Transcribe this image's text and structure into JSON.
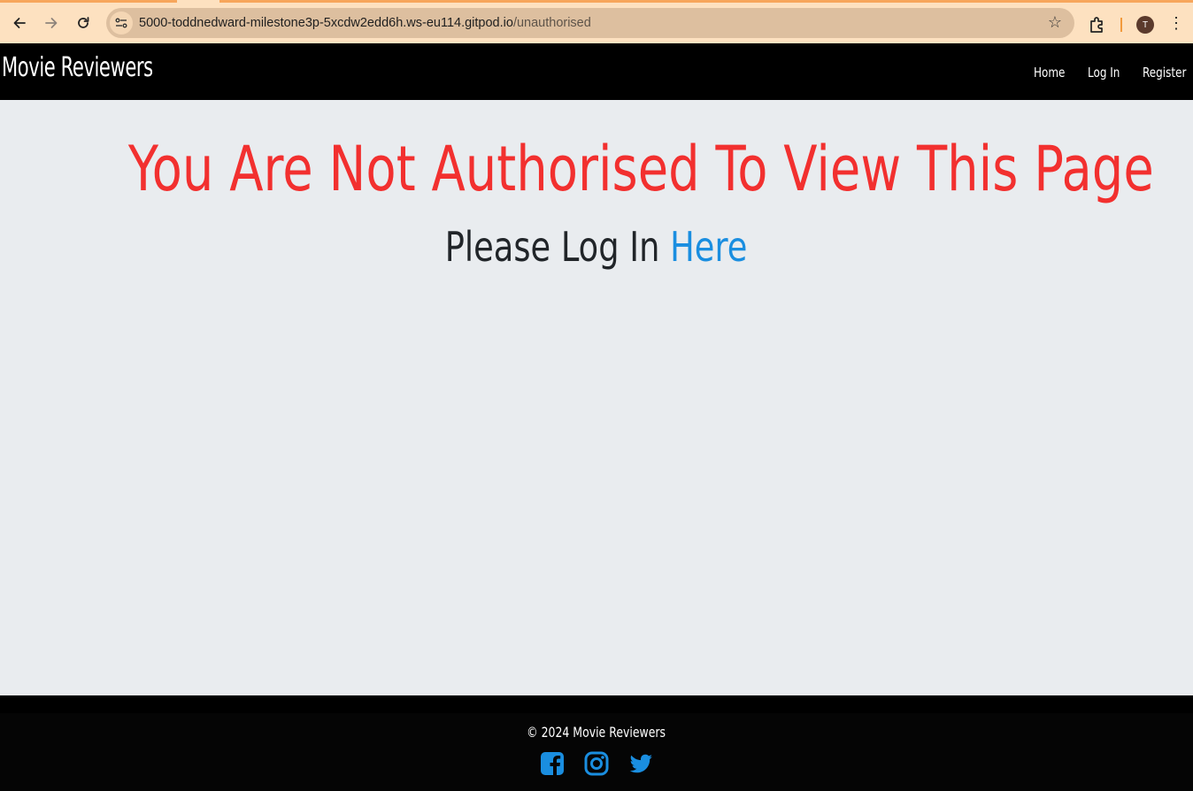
{
  "browser": {
    "url_host": "5000-toddnedward-milestone3p-5xcdw2edd6h.ws-eu114.gitpod.io",
    "url_path": "/unauthorised",
    "profile_initial": "T",
    "icons": [
      "back-icon",
      "forward-icon",
      "reload-icon",
      "site-info-icon",
      "bookmark-star-icon",
      "extensions-icon",
      "menu-icon"
    ]
  },
  "navbar": {
    "brand": "Movie Reviewers",
    "links": [
      {
        "label": "Home"
      },
      {
        "label": "Log In"
      },
      {
        "label": "Register"
      }
    ]
  },
  "main": {
    "headline": "You Are Not Authorised To View This Page",
    "prompt_text": "Please Log In",
    "link_text": "Here"
  },
  "footer": {
    "copyright": "© 2024 Movie Reviewers",
    "socials": [
      "facebook-icon",
      "instagram-icon",
      "twitter-icon"
    ]
  },
  "colors": {
    "headline": "#f2302f",
    "link": "#1a8ee0",
    "navbar_bg": "#000000",
    "page_bg": "#e9ecef"
  }
}
